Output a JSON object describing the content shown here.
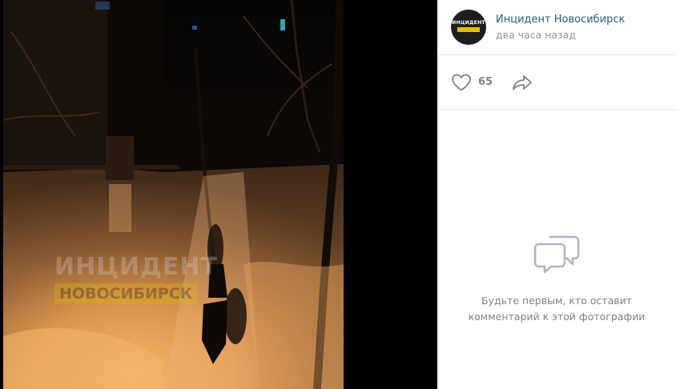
{
  "post": {
    "author_name": "Инцидент Новосибирск",
    "time": "два часа назад",
    "avatar_line1": "ИНЦИДЕНТ"
  },
  "photo": {
    "watermark_line1": "ИНЦИДЕНТ",
    "watermark_line2": "НОВОСИБИРСК"
  },
  "actions": {
    "like_count": "65",
    "like_icon": "heart-icon",
    "share_icon": "share-arrow-icon"
  },
  "comments": {
    "empty_icon": "comments-bubbles-icon",
    "empty_line1": "Будьте первым, кто оставит",
    "empty_line2": "комментарий к этой фотографии"
  },
  "colors": {
    "link": "#2a5885",
    "muted": "#828282",
    "divider": "#e7e8ec",
    "accent_yellow": "#e6c000"
  }
}
